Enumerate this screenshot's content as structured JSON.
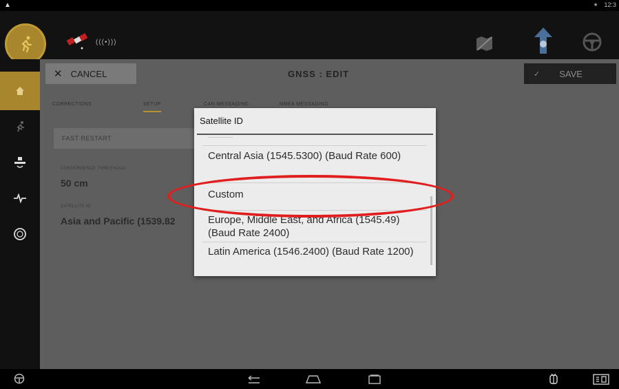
{
  "status_bar": {
    "right_icons": [
      "bluetooth-icon",
      "clock"
    ],
    "time": "12:3"
  },
  "top_bar": {
    "signal_label": "(((•)))",
    "icons": [
      "running-icon",
      "satellite-icon",
      "map-disabled-icon",
      "guidance-icon",
      "steering-wheel-icon"
    ]
  },
  "sidebar": {
    "items": [
      {
        "icon": "home-icon",
        "active": true
      },
      {
        "icon": "running-icon",
        "active": false
      },
      {
        "icon": "satellite-icon",
        "active": false
      },
      {
        "icon": "pulse-icon",
        "active": false
      },
      {
        "icon": "steering-icon",
        "active": false
      }
    ]
  },
  "action_bar": {
    "cancel_label": "CANCEL",
    "title": "GNSS : EDIT",
    "save_label": "SAVE"
  },
  "tabs": [
    {
      "label": "CORRECTIONS",
      "active": false
    },
    {
      "label": "SETUP",
      "active": true
    },
    {
      "label": "CAN MESSAGING",
      "active": false
    },
    {
      "label": "NMEA MESSAGING",
      "active": false
    }
  ],
  "form": {
    "fast_restart_label": "FAST RESTART",
    "field1_label": "CONVERGENCE THRESHOLD",
    "field1_value": "50 cm",
    "field2_label": "SATELLITE ID",
    "field2_value": "Asia and Pacific (1539.82"
  },
  "dialog": {
    "title": "Satellite ID",
    "options": [
      "Central Asia (1545.5300) (Baud Rate 600)",
      "Custom",
      "Europe, Middle East, and Africa (1545.49) (Baud Rate 2400)",
      "Latin America (1546.2400) (Baud Rate 1200)"
    ]
  },
  "colors": {
    "accent": "#a8862d",
    "highlight": "#e01e1e",
    "dialog_bg": "#ececec",
    "dim_bg": "#5e5e5e"
  }
}
